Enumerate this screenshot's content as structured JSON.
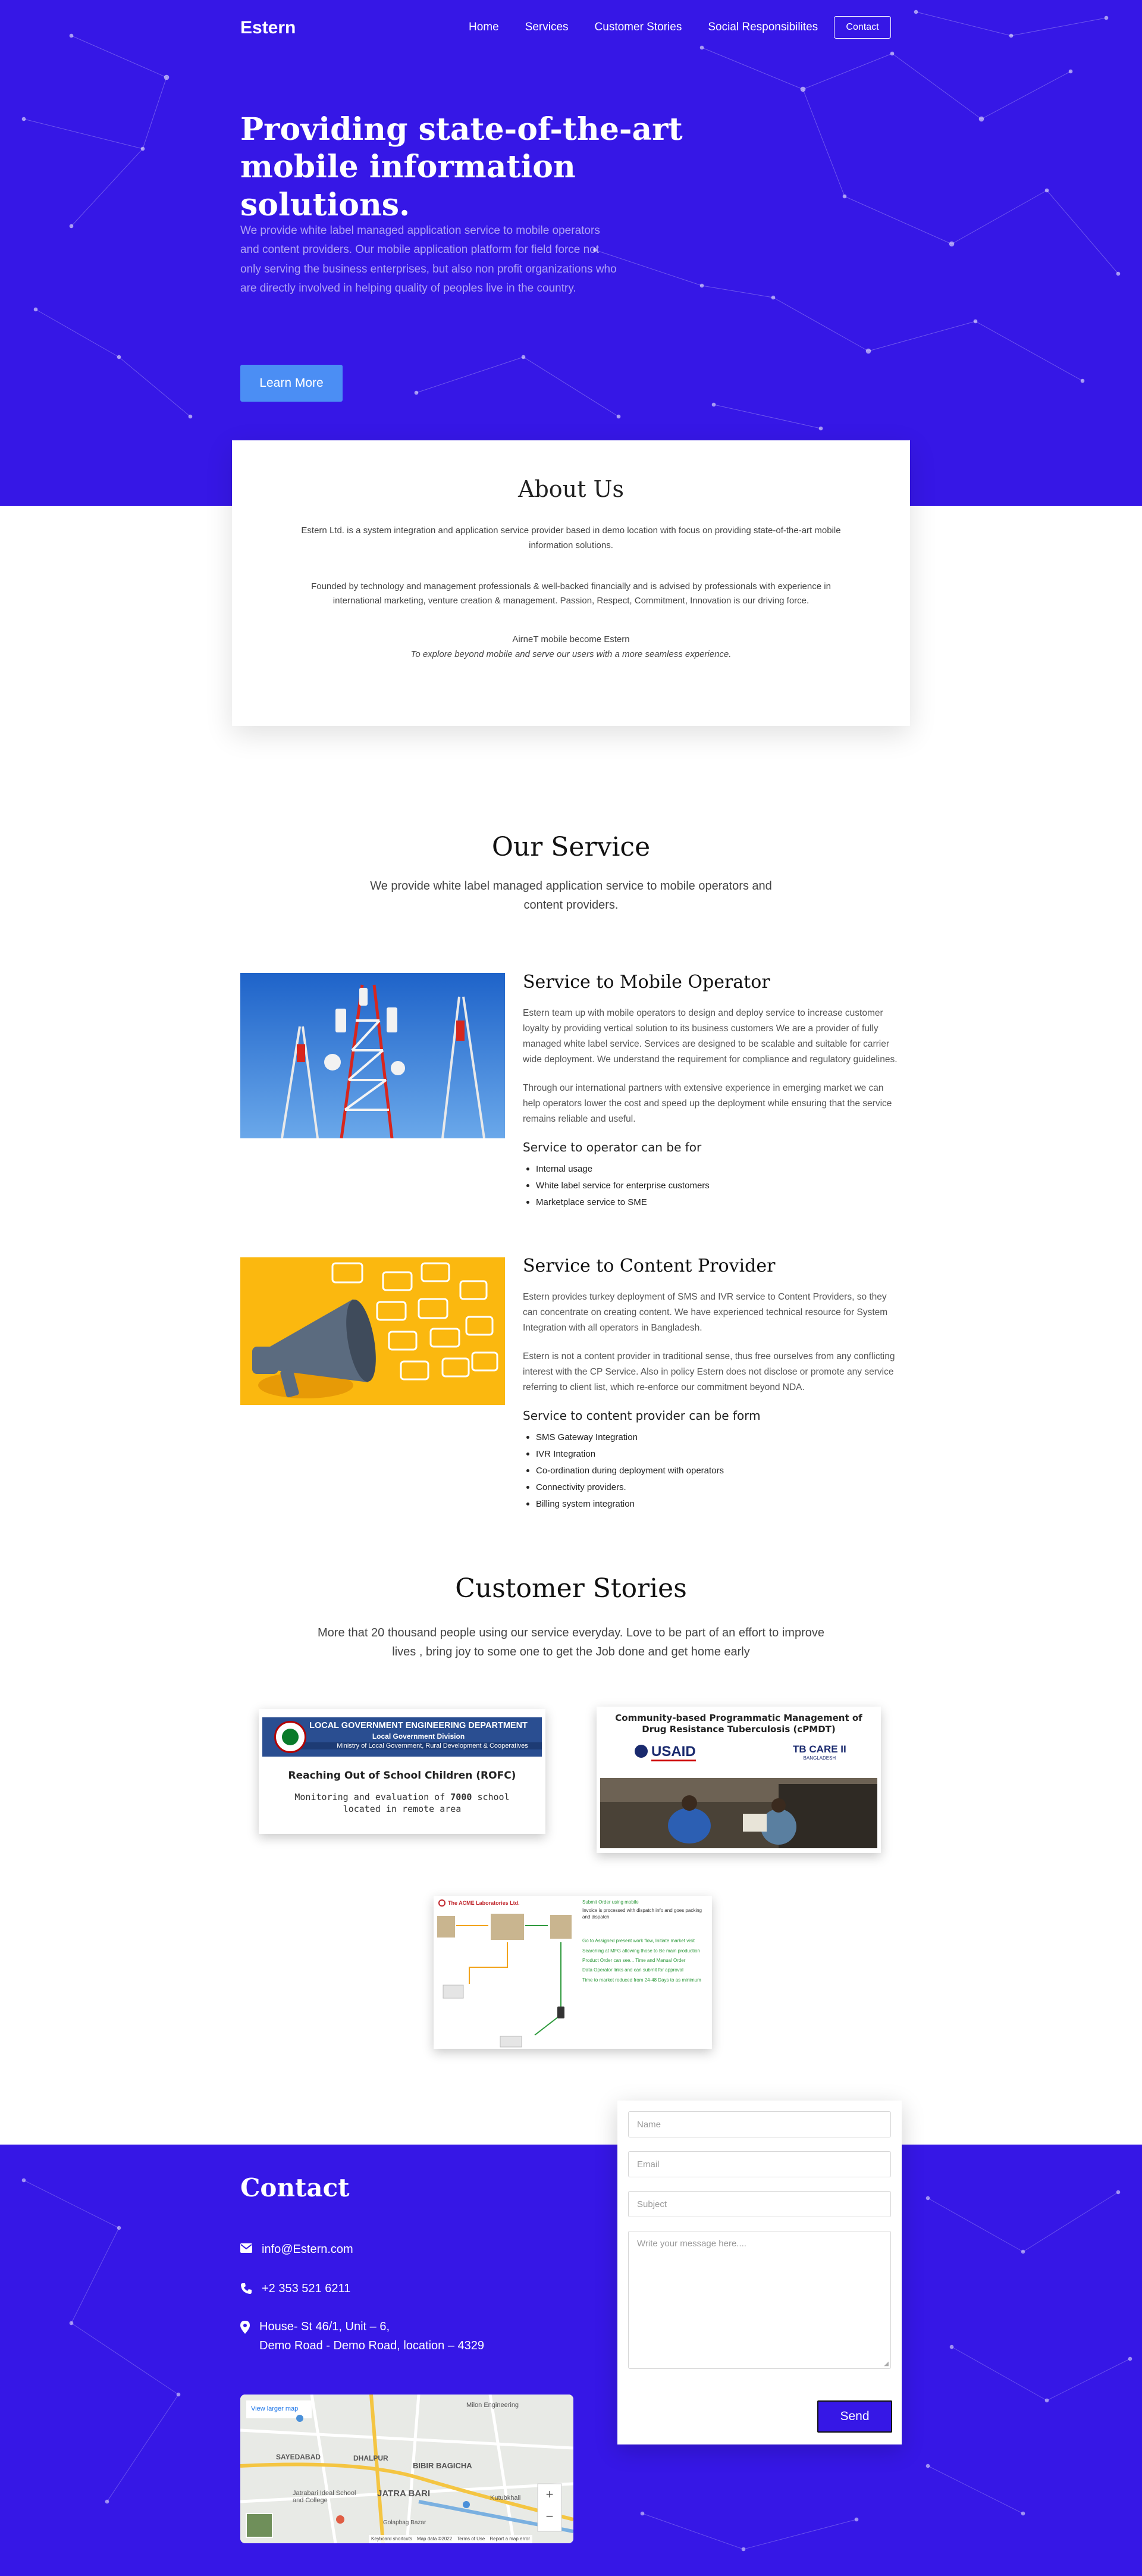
{
  "nav": {
    "brand": "Estern",
    "items": [
      "Home",
      "Services",
      "Customer Stories",
      "Social Responsibilites"
    ],
    "contact": "Contact"
  },
  "hero": {
    "title": "Providing state-of-the-art mobile information solutions.",
    "text": "We provide white label managed application service to mobile operators and content providers. Our mobile application platform for field force not only serving the business enterprises, but also non profit organizations who are directly involved in helping quality of peoples live in the country.",
    "button": "Learn More"
  },
  "about": {
    "title": "About Us",
    "p1": "Estern Ltd. is a system integration and application service provider based in demo location with focus on providing state-of-the-art mobile information solutions.",
    "p2": "Founded by technology and management professionals & well-backed financially and is advised by professionals with experience in international marketing, venture creation & management. Passion, Respect, Commitment, Innovation is our driving force.",
    "p3": "AirneT mobile become Estern",
    "p3_em": "To explore beyond mobile and serve our users with a more seamless experience."
  },
  "services": {
    "title": "Our Service",
    "subtitle": "We provide white label managed application service to mobile operators and content providers.",
    "items": [
      {
        "title": "Service to Mobile Operator",
        "p1": "Estern team up with mobile operators to design and deploy service to increase customer loyalty by providing vertical solution to its business customers We are a provider of fully managed white label service. Services are designed to be scalable and suitable for carrier wide deployment. We understand the requirement for compliance and regulatory guidelines.",
        "p2": "Through our international partners with extensive experience in emerging market we can help operators lower the cost and speed up the deployment while ensuring that the service remains reliable and useful.",
        "list_title": "Service to operator can be for",
        "list": [
          "Internal usage",
          "White label service for enterprise customers",
          "Marketplace service to SME"
        ]
      },
      {
        "title": "Service to Content Provider",
        "p1": "Estern provides turkey deployment of SMS and IVR service to Content Providers, so they can concentrate on creating content. We have experienced technical resource for System Integration with all operators in Bangladesh.",
        "p2": "Estern is not a content provider in traditional sense, thus free ourselves from any conflicting interest with the CP Service. Also in policy Estern does not disclose or promote any service referring to client list, which re-enforce our commitment beyond NDA.",
        "list_title": "Service to content provider can be form",
        "list": [
          "SMS Gateway Integration",
          "IVR Integration",
          "Co-ordination during deployment with operators",
          "Connectivity providers.",
          "Billing system integration"
        ]
      }
    ]
  },
  "stories": {
    "title": "Customer Stories",
    "subtitle": "More that 20 thousand people using our service everyday. Love to be part of an effort to improve lives , bring joy to some one to get the Job done and get home early",
    "lged": {
      "t1": "LOCAL GOVERNMENT ENGINEERING DEPARTMENT",
      "t2": "Local Government Division",
      "t3": "Ministry of Local Government, Rural Development & Cooperatives",
      "heading": "Reaching Out of School Children (ROFC)",
      "desc1": "Monitoring and evaluation of",
      "desc_num": "7000",
      "desc2": "school located in remote area"
    },
    "tb": {
      "title": "Community-based Programmatic Management of Drug Resistance Tuberculosis (cPMDT)",
      "usaid": "USAID",
      "tbcare": "TB CARE II",
      "tbcare_sub": "BANGLADESH"
    },
    "acme": {
      "header": "The ACME Laboratories Ltd.",
      "step2": "Submit Order using mobile",
      "step3": "Invoice is processed with dispatch info and goes packing and dispatch",
      "notes": [
        "Go to Assigned present work flow, Initiate market visit",
        "Searching at MFG allowing those to Be main production",
        "Product Order can see... Time and Manual Order",
        "Data Operator links and can submit for approval",
        "Time to market reduced from 24-48 Days to as minimum"
      ]
    }
  },
  "contact": {
    "title": "Contact",
    "email": "info@Estern.com",
    "phone": "+2 353 521 6211",
    "address1": "House- St 46/1, Unit – 6,",
    "address2": "Demo Road - Demo Road, location – 4329",
    "map": {
      "view_larger": "View larger map",
      "labels": [
        "SAYEDABAD",
        "DHALPUR",
        "BIBIR BAGICHA",
        "JATRA BARI",
        "Jatrabari Ideal School and College",
        "Golapbag Bazar",
        "Kutubkhali",
        "Milon Engineering"
      ],
      "attribution": [
        "Keyboard shortcuts",
        "Map data ©2022",
        "Terms of Use",
        "Report a map error"
      ]
    },
    "form": {
      "name": "Name",
      "email": "Email",
      "subject": "Subject",
      "message": "Write your message here....",
      "send": "Send"
    }
  },
  "colors": {
    "primary": "#3617e6",
    "button": "#4b8ef4"
  }
}
